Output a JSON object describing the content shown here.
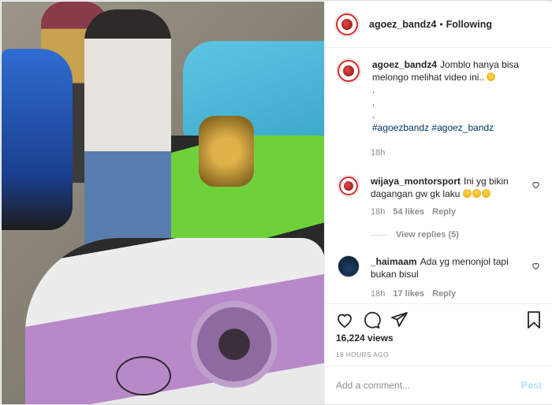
{
  "post": {
    "username": "agoez_bandz4",
    "separator": "•",
    "follow_status": "Following"
  },
  "caption": {
    "username": "agoez_bandz4",
    "text": "Jomblo hanya bisa melongo melihat video ini..",
    "emoji": "grinning-squint-emoji",
    "dots": ".",
    "hashtags": [
      "#agoezbandz",
      "#agoez_bandz"
    ],
    "time": "18h"
  },
  "comments": [
    {
      "username": "wijaya_montorsport",
      "text": "Ini yg bikin dagangan gw gk laku",
      "emojis": [
        "laughing-emoji",
        "laughing-emoji",
        "laughing-emoji"
      ],
      "time": "18h",
      "likes": "54 likes",
      "reply": "Reply",
      "view_replies": "View replies (5)"
    },
    {
      "username": "_haimaam",
      "text": "Ada yg menonjol tapi bukan bisul",
      "time": "18h",
      "likes": "17 likes",
      "reply": "Reply"
    }
  ],
  "actions": {
    "like_icon": "heart-icon",
    "comment_icon": "comment-bubble-icon",
    "share_icon": "paper-plane-icon",
    "save_icon": "bookmark-icon"
  },
  "stats": {
    "views": "16,224 views",
    "ago": "18 HOURS AGO"
  },
  "composer": {
    "placeholder": "Add a comment...",
    "post_label": "Post"
  },
  "colors": {
    "accent": "#0095f6",
    "post_disabled": "#b2dffc",
    "secondary_text": "#8e8e8e",
    "hashtag": "#003569"
  }
}
